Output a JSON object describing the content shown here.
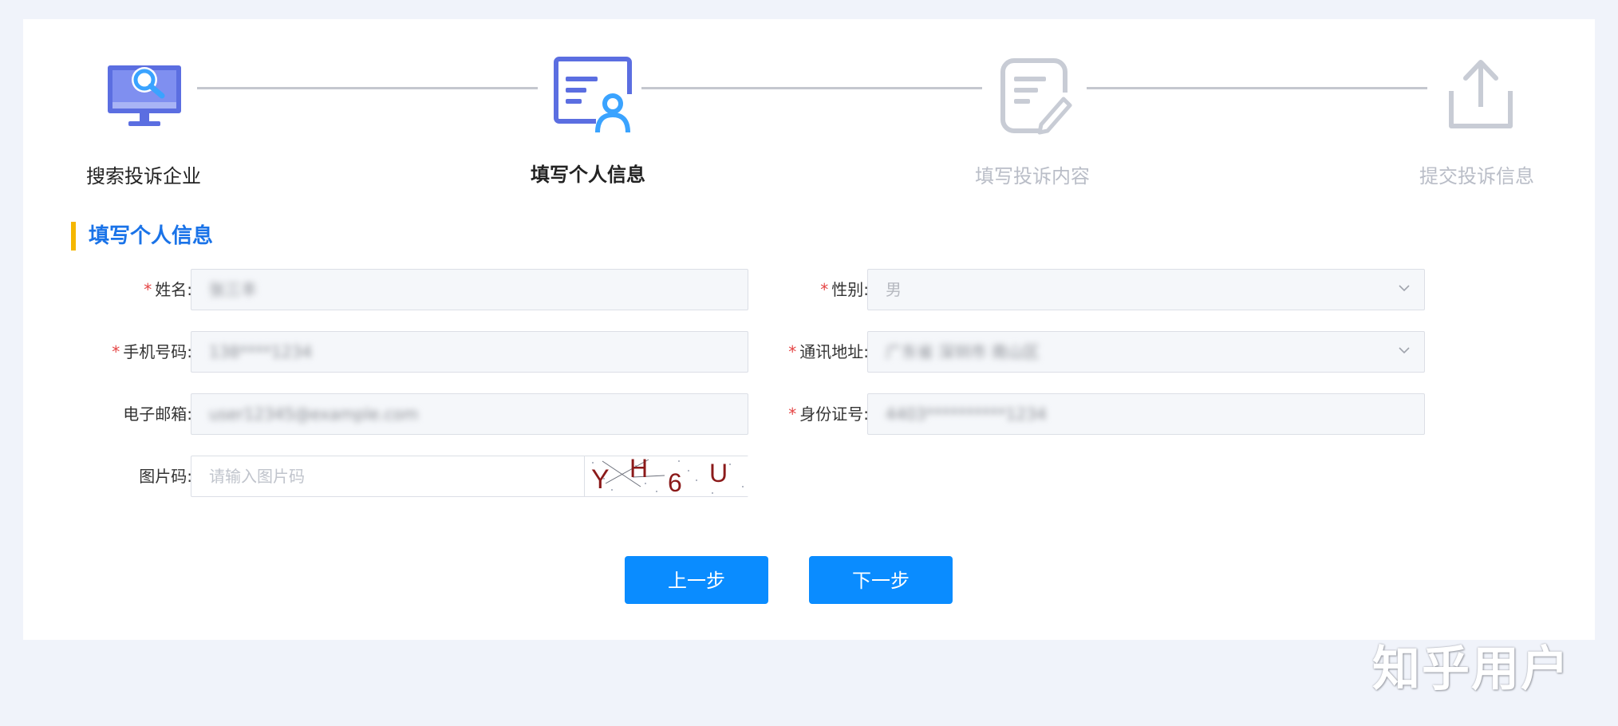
{
  "steps": [
    {
      "label": "搜索投诉企业",
      "state": "done",
      "icon": "monitor-search-icon"
    },
    {
      "label": "填写个人信息",
      "state": "active",
      "icon": "user-profile-card-icon"
    },
    {
      "label": "填写投诉内容",
      "state": "todo",
      "icon": "document-edit-icon"
    },
    {
      "label": "提交投诉信息",
      "state": "todo",
      "icon": "upload-icon"
    }
  ],
  "section": {
    "title": "填写个人信息"
  },
  "form": {
    "name": {
      "label": "姓名:",
      "required": true,
      "value": "张三丰"
    },
    "gender": {
      "label": "性别:",
      "required": true,
      "value": "男"
    },
    "phone": {
      "label": "手机号码:",
      "required": true,
      "value": "138****1234"
    },
    "address": {
      "label": "通讯地址:",
      "required": true,
      "value": "广东省 深圳市 南山区"
    },
    "email": {
      "label": "电子邮箱:",
      "required": false,
      "value": "user12345@example.com"
    },
    "id_number": {
      "label": "身份证号:",
      "required": true,
      "value": "4403**********1234"
    },
    "captcha": {
      "label": "图片码:",
      "required": false,
      "placeholder": "请输入图片码",
      "value": "",
      "image_text": [
        "Y",
        "H",
        "6",
        "U"
      ]
    }
  },
  "buttons": {
    "prev": "上一步",
    "next": "下一步"
  },
  "watermark": "知乎用户",
  "colors": {
    "primary": "#0a8cff",
    "section_title": "#1a73e8",
    "accent_bar": "#f5b700",
    "required_star": "#e54545",
    "icon_active": "#5b6ee1",
    "icon_active_accent": "#3aa3ff",
    "icon_inactive": "#c8ccd5"
  }
}
